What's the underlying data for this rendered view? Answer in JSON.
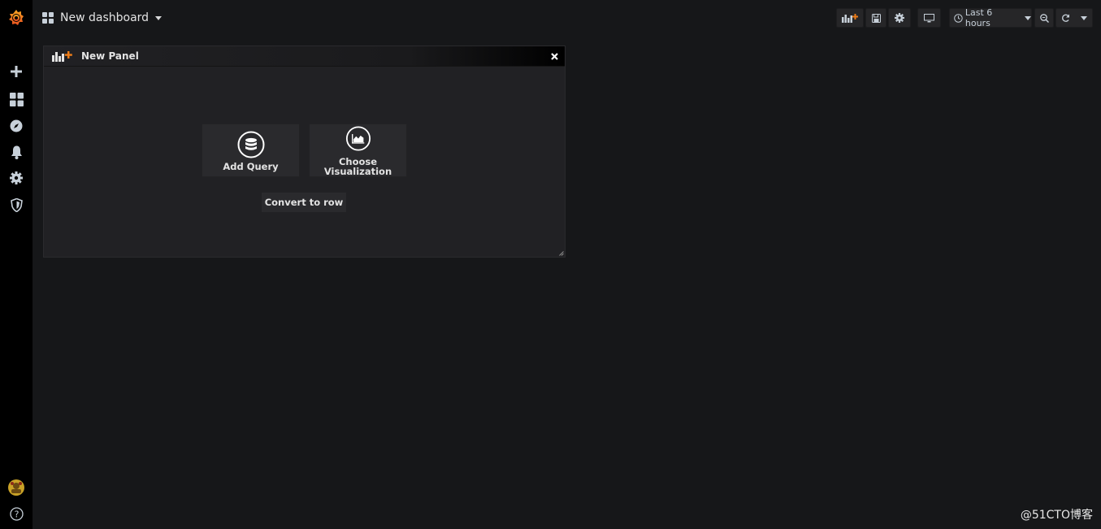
{
  "topbar": {
    "dashboard_title": "New dashboard",
    "time_range_label": "Last 6 hours"
  },
  "sidebar": {
    "items": [
      {
        "icon": "plus-icon"
      },
      {
        "icon": "dashboards-icon"
      },
      {
        "icon": "explore-icon"
      },
      {
        "icon": "bell-icon"
      },
      {
        "icon": "gear-icon"
      },
      {
        "icon": "shield-icon"
      }
    ],
    "bottom": [
      {
        "icon": "avatar"
      },
      {
        "icon": "help-icon"
      }
    ]
  },
  "panel": {
    "title": "New Panel",
    "add_query_label": "Add Query",
    "choose_vis_line1": "Choose",
    "choose_vis_line2": "Visualization",
    "convert_label": "Convert to row"
  },
  "watermark": "@51CTO博客",
  "colors": {
    "background": "#161719",
    "sidebar": "#000000",
    "panel": "#212124",
    "accent": "#eb7b18"
  }
}
